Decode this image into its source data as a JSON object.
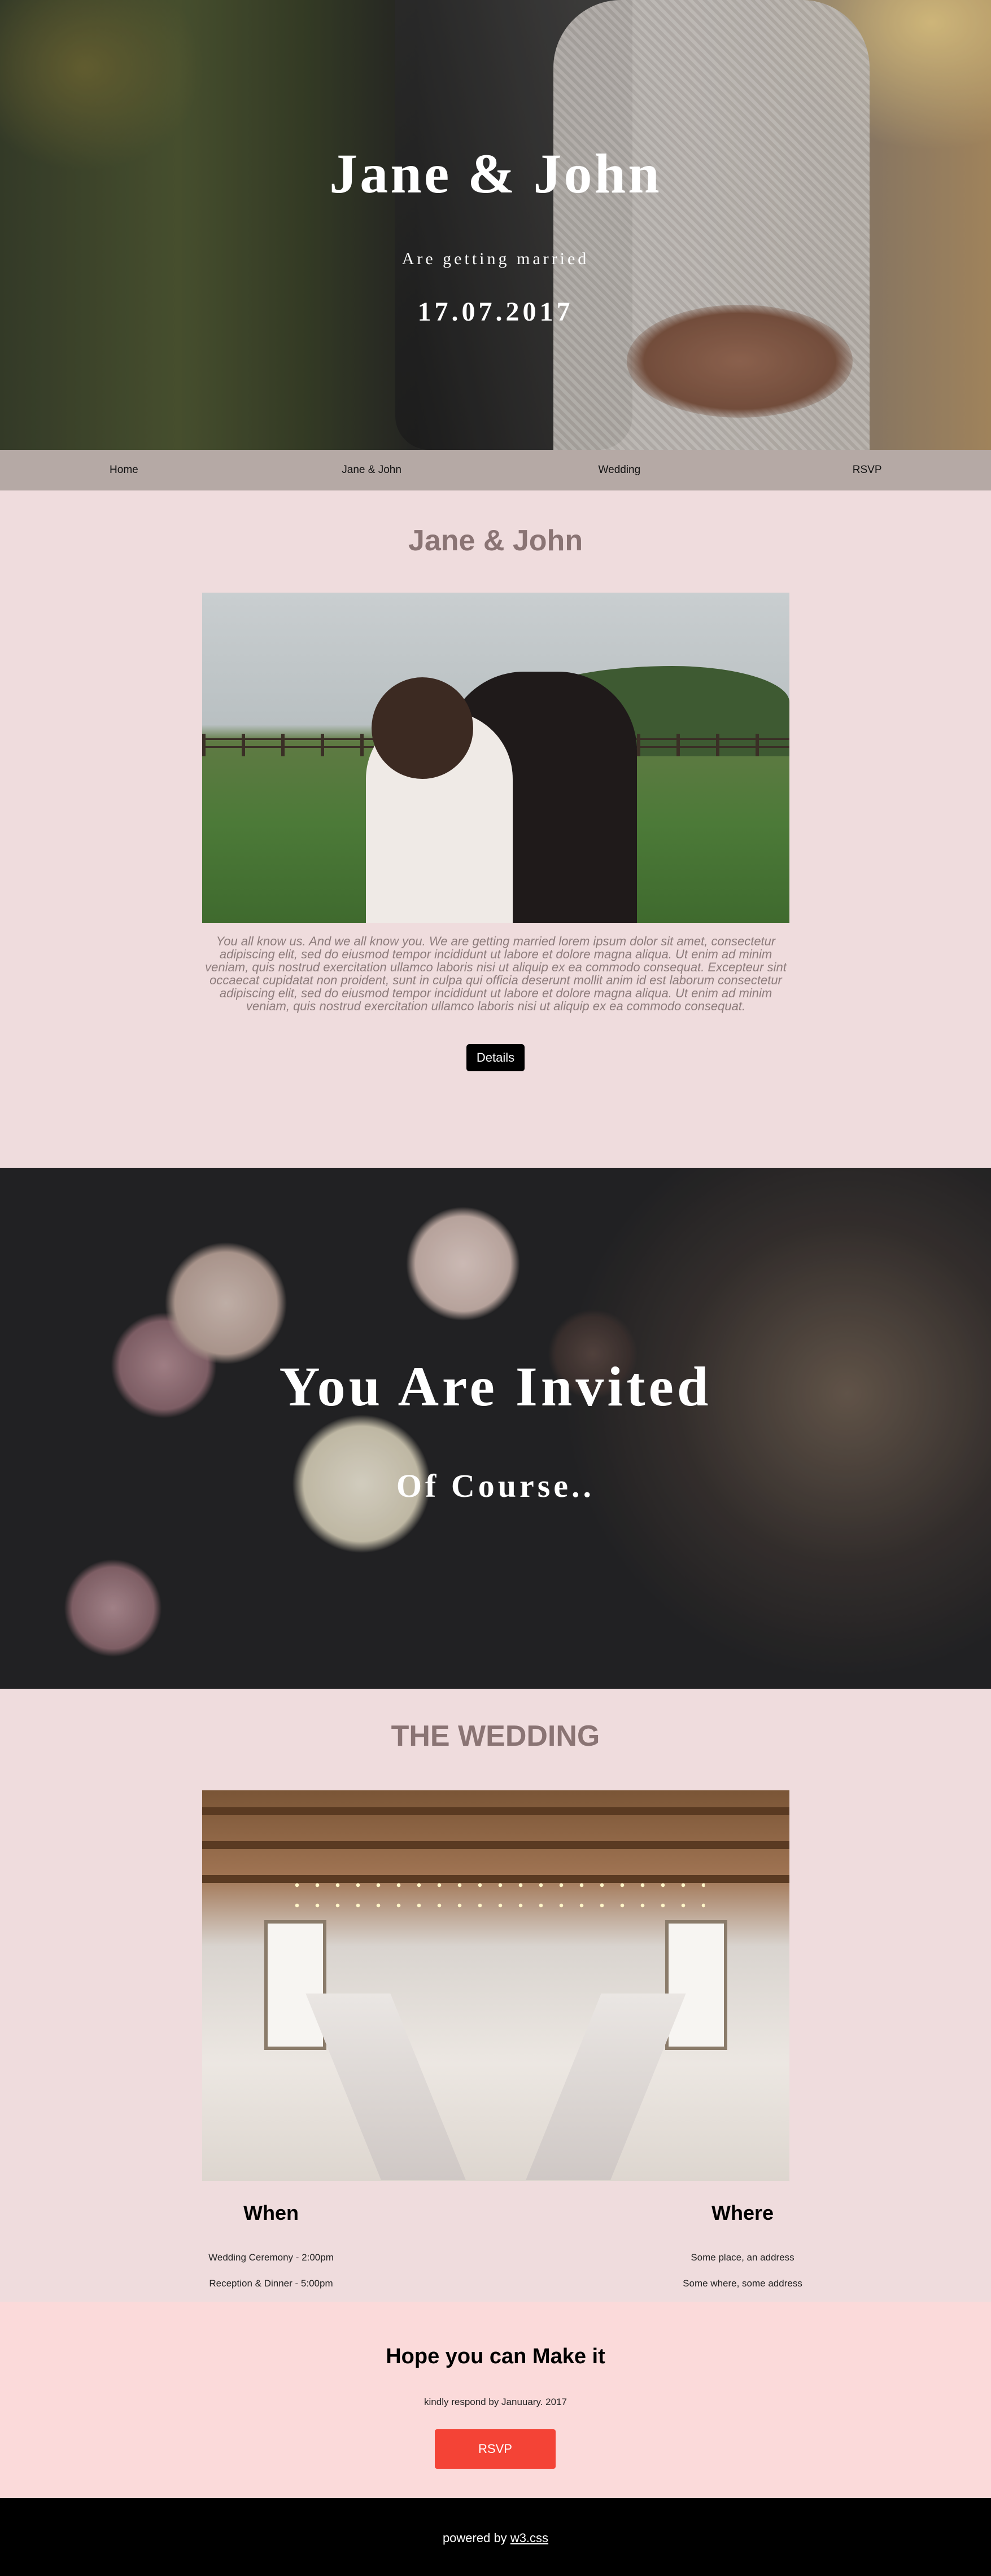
{
  "hero": {
    "title": "Jane & John",
    "tagline": "Are getting married",
    "date": "17.07.2017"
  },
  "nav": {
    "items": [
      {
        "label": "Home"
      },
      {
        "label": "Jane & John"
      },
      {
        "label": "Wedding"
      },
      {
        "label": "RSVP"
      }
    ]
  },
  "about": {
    "title": "Jane & John",
    "text": "You all know us. And we all know you. We are getting married lorem ipsum dolor sit amet, consectetur adipiscing elit, sed do eiusmod tempor incididunt ut labore et dolore magna aliqua. Ut enim ad minim veniam, quis nostrud exercitation ullamco laboris nisi ut aliquip ex ea commodo consequat. Excepteur sint occaecat cupidatat non proident, sunt in culpa qui officia deserunt mollit anim id est laborum consectetur adipiscing elit, sed do eiusmod tempor incididunt ut labore et dolore magna aliqua. Ut enim ad minim veniam, quis nostrud exercitation ullamco laboris nisi ut aliquip ex ea commodo consequat.",
    "details_label": "Details"
  },
  "invite": {
    "title": "You Are Invited",
    "subtitle": "Of Course.."
  },
  "wedding": {
    "title": "THE WEDDING",
    "when": {
      "title": "When",
      "lines": [
        "Wedding Ceremony - 2:00pm",
        "Reception & Dinner - 5:00pm"
      ]
    },
    "where": {
      "title": "Where",
      "lines": [
        "Some place, an address",
        "Some where, some address"
      ]
    }
  },
  "rsvp": {
    "title": "Hope you can Make it",
    "note": "kindly respond by Januuary. 2017",
    "button_label": "RSVP",
    "button_color": "#f44336"
  },
  "footer": {
    "prefix": "powered by",
    "link_label": "w3.css"
  }
}
